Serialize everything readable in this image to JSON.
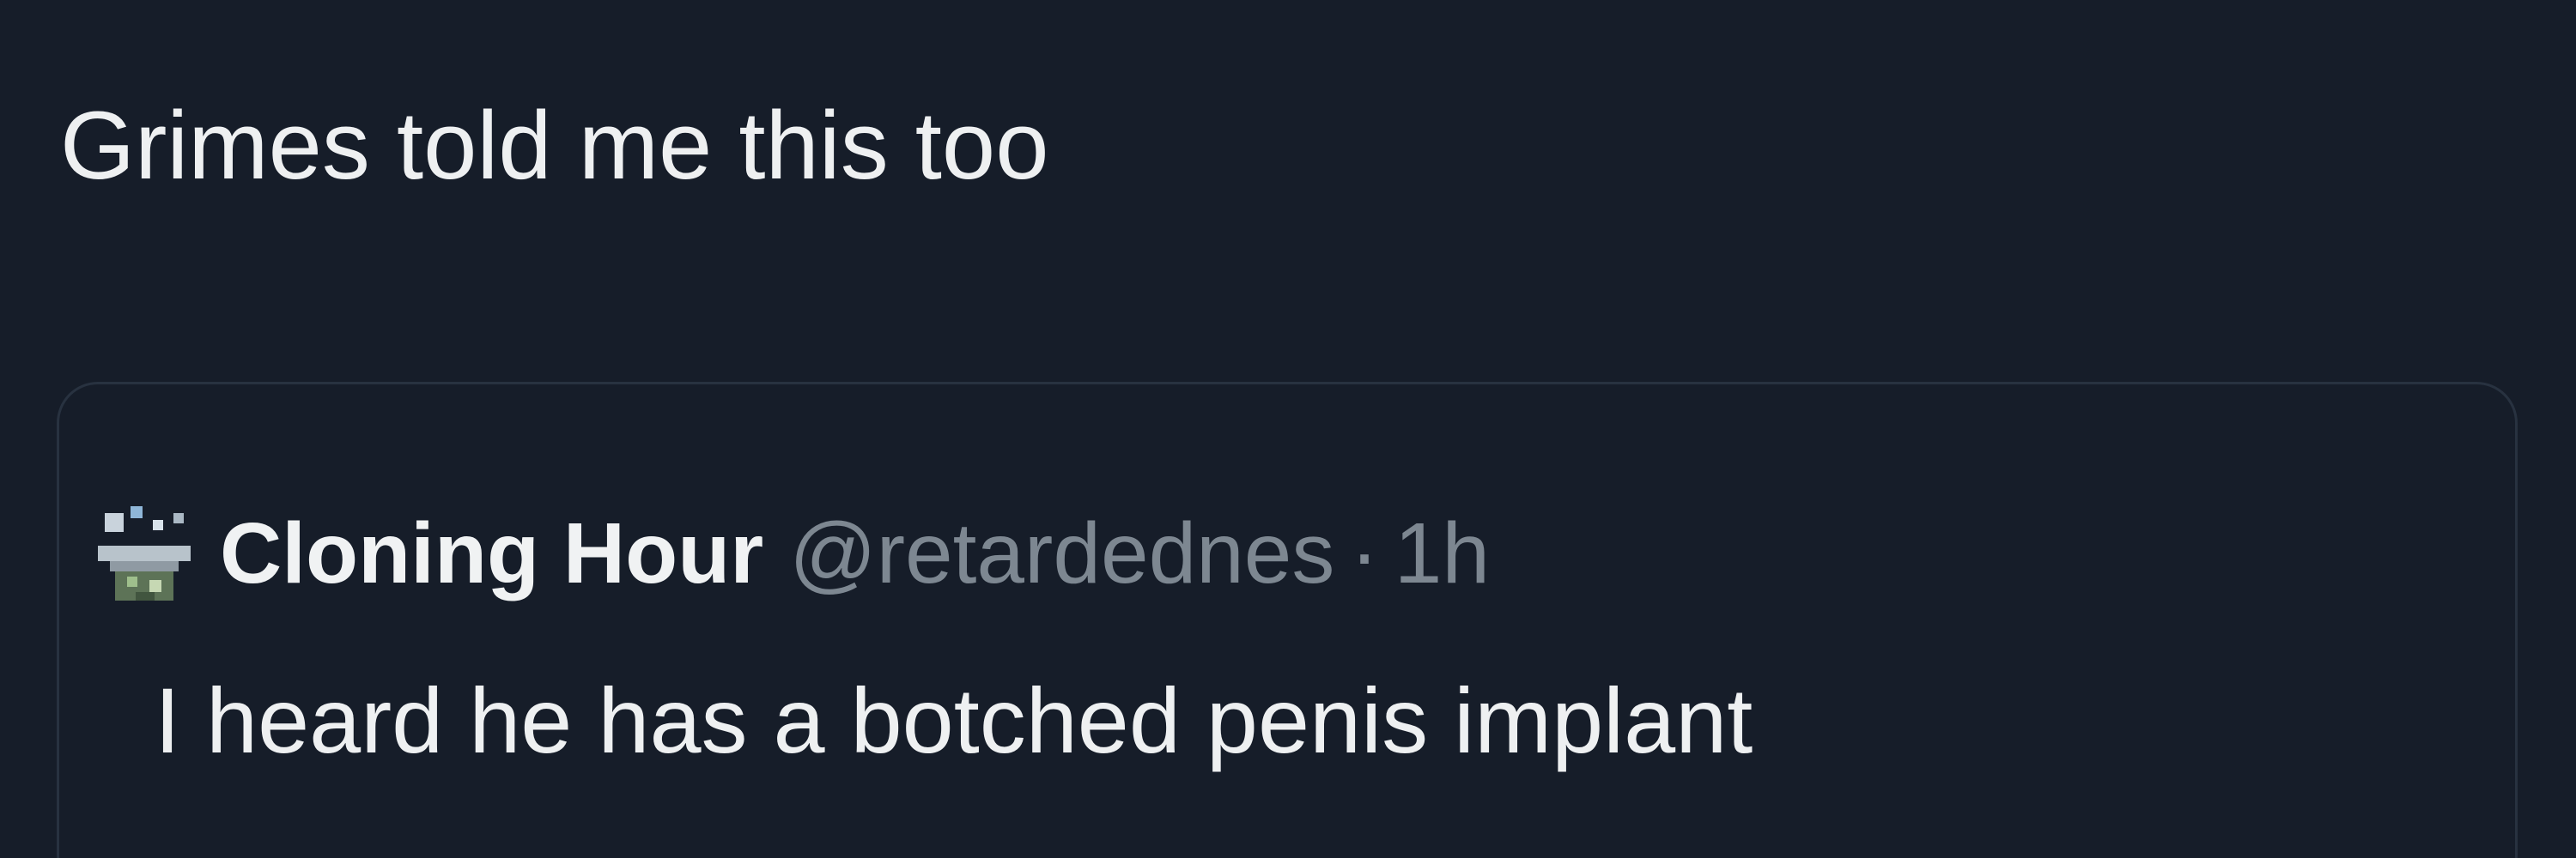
{
  "tweet": {
    "text": "Grimes told me this too"
  },
  "quoted_tweet": {
    "display_name": "Cloning Hour",
    "handle": "@retardednes",
    "separator": "·",
    "time": "1h",
    "text": "I heard he has a botched penis implant",
    "avatar_icon": "pixel-art-avatar-icon"
  },
  "colors": {
    "background": "#161d29",
    "primary_text": "#eef0f1",
    "secondary_text": "#7d8791",
    "card_border": "#283240"
  }
}
